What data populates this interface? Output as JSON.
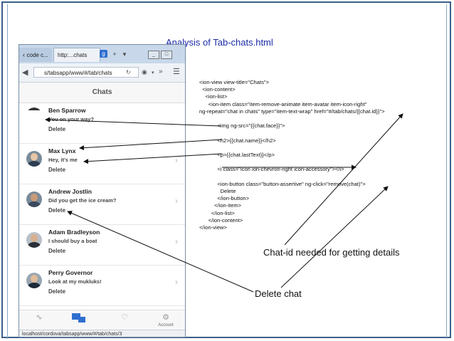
{
  "slide": {
    "title": "Analysis of Tab-chats.html"
  },
  "browser": {
    "tabs": [
      {
        "label": "code c..."
      },
      {
        "label": "http:...chats"
      }
    ],
    "window_controls": [
      "_",
      "□",
      "x"
    ],
    "url": "s/tabsapp/www/#/tab/chats",
    "status_url": "localhost/cordova/tabsapp/www/#/tab/chats/3"
  },
  "app": {
    "header_title": "Chats",
    "chats": [
      {
        "name": "Ben Sparrow",
        "last_text": "You on your way?",
        "delete": "Delete"
      },
      {
        "name": "Max Lynx",
        "last_text": "Hey, it's me",
        "delete": "Delete"
      },
      {
        "name": "Andrew Jostlin",
        "last_text": "Did you get the ice cream?",
        "delete": "Delete"
      },
      {
        "name": "Adam Bradleyson",
        "last_text": "I should buy a boat",
        "delete": "Delete"
      },
      {
        "name": "Perry Governor",
        "last_text": "Look at my mukluks!",
        "delete": "Delete"
      }
    ],
    "bottom_tabs": [
      {
        "icon": "pulse-icon",
        "label": ""
      },
      {
        "icon": "chats-icon",
        "label": ""
      },
      {
        "icon": "heart-icon",
        "label": ""
      },
      {
        "icon": "gear-icon",
        "label": "Account"
      }
    ]
  },
  "code": {
    "lines": [
      "<ion-view view-title=\"Chats\">",
      "  <ion-content>",
      "    <ion-list>",
      "      <ion-item class=\"item-remove-animate item-avatar item-icon-right\"",
      "ng-repeat=\"chat in chats\" type=\"item-text-wrap\" href=\"#/tab/chats/{{chat.id}}\">",
      "",
      "            <img ng-src=\"{{chat.face}}\">",
      "",
      "            <h2>{{chat.name}}</h2>",
      "",
      "            <p>{{chat.lastText}}</p>",
      "",
      "            <i class=\"icon ion-chevron-right icon-accessory\"></i>",
      "",
      "            <ion-button class=\"button-assertive\" ng-click=\"remove(chat)\">",
      "              Delete",
      "            </ion-button>",
      "          </ion-item>",
      "        </ion-list>",
      "      </ion-content>",
      "</ion-view>"
    ]
  },
  "annotations": {
    "chat_id_label": "Chat-id needed for getting details",
    "delete_label": "Delete chat"
  },
  "colors": {
    "title": "#1a2aa6",
    "frame": "#3a5f8a",
    "tab_bar": "#c8d8ea",
    "chat_tab_active": "#2f6fd0"
  }
}
